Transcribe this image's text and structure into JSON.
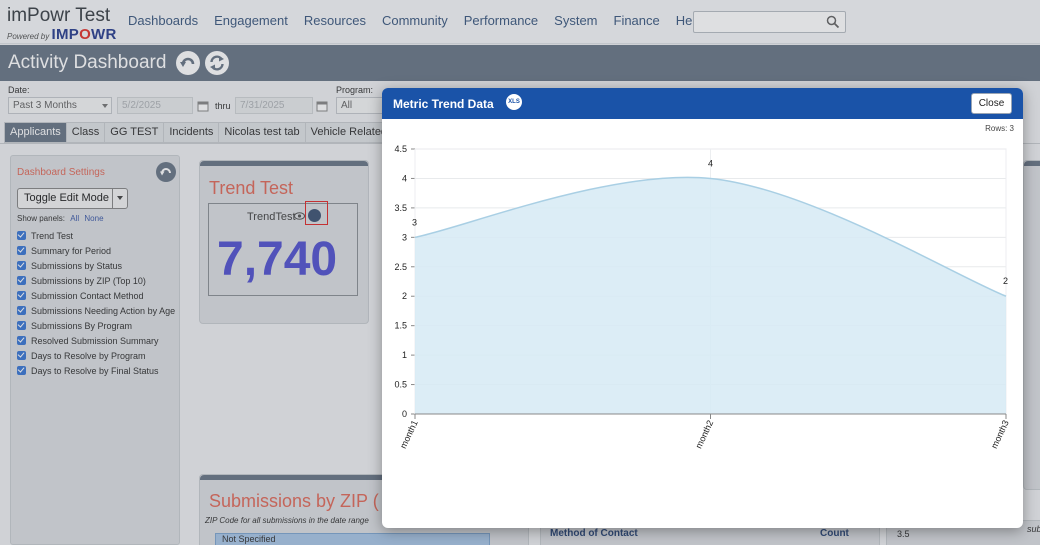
{
  "app": {
    "title": "imPowr Test",
    "powered_by": "Powered by",
    "brand_logo": "IMPOWR"
  },
  "nav": {
    "items": [
      "Dashboards",
      "Engagement",
      "Resources",
      "Community",
      "Performance",
      "System",
      "Finance",
      "Help"
    ],
    "search_placeholder": ""
  },
  "page": {
    "title": "Activity Dashboard"
  },
  "filters": {
    "date_label": "Date:",
    "date_range_value": "Past 3 Months",
    "start_date": "5/2/2025",
    "thru_label": "thru",
    "end_date": "7/31/2025",
    "program_label": "Program:",
    "program_value": "All"
  },
  "tabs": [
    "Applicants",
    "Class",
    "GG TEST",
    "Incidents",
    "Nicolas test tab",
    "Vehicle Related Que"
  ],
  "settings": {
    "title": "Dashboard Settings",
    "toggle_label": "Toggle Edit Mode",
    "show_panels_label": "Show panels:",
    "all_link": "All",
    "none_link": "None",
    "panels": [
      "Trend Test",
      "Summary for Period",
      "Submissions by Status",
      "Submissions by ZIP (Top 10)",
      "Submission Contact Method",
      "Submissions Needing Action by Age",
      "Submissions By Program",
      "Resolved Submission Summary",
      "Days to Resolve by Program",
      "Days to Resolve by Final Status"
    ]
  },
  "trend_card": {
    "title": "Trend Test",
    "metric_label": "TrendTest",
    "value": "7,740"
  },
  "zip_card": {
    "title": "Submissions by ZIP (",
    "subtitle": "ZIP Code for all submissions in the date range",
    "row_label": "Not Specified"
  },
  "contact_card": {
    "col_method": "Method of Contact",
    "col_count": "Count"
  },
  "side_card": {
    "tick": "3.5",
    "fragment": "submi"
  },
  "modal": {
    "title": "Metric Trend Data",
    "xls_label": "XLS",
    "close_label": "Close",
    "rows_label": "Rows: 3"
  },
  "colors": {
    "header_blue": "#1a53a8",
    "area_fill": "#d6eaf4",
    "area_line": "#a9cfe4",
    "title_accent": "#e06b5b",
    "big_number": "#5353d0"
  },
  "chart_data": {
    "type": "area",
    "categories": [
      "month1",
      "month2",
      "month3"
    ],
    "values": [
      3,
      4,
      2
    ],
    "title": "",
    "xlabel": "",
    "ylabel": "",
    "ylim": [
      0,
      4.5
    ],
    "yticks": [
      "0",
      "0.5",
      "1",
      "1.5",
      "2",
      "2.5",
      "3",
      "3.5",
      "4",
      "4.5"
    ],
    "grid": true,
    "data_labels": [
      "3",
      "4",
      "2"
    ]
  }
}
